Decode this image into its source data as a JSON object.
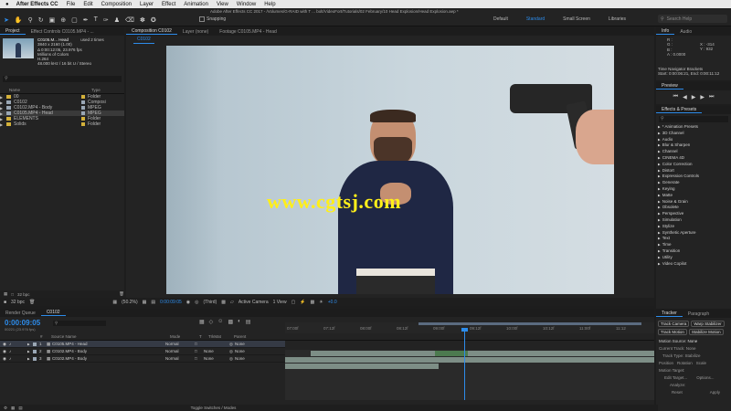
{
  "menubar": {
    "apple": "",
    "items": [
      "After Effects CC",
      "File",
      "Edit",
      "Composition",
      "Layer",
      "Effect",
      "Animation",
      "View",
      "Window",
      "Help"
    ]
  },
  "window": {
    "title": "Adobe After Effects CC 2017 - /Volumes/G-RAID with T ... bolt/VideoFort/Tutorials/02 February/10 Head Explosion/Head Explosion.aep *"
  },
  "toolbar": {
    "snapping": "Snapping",
    "workspaces": [
      "Default",
      "Standard",
      "Small Screen",
      "Libraries"
    ],
    "active_workspace": "Standard",
    "search_placeholder": "Search Help"
  },
  "project_panel": {
    "tabs": [
      "Project",
      "Effect Controls C0105.MP4 - ..."
    ],
    "selected_name": "C0105.M... Head",
    "used": "used 2 times",
    "info_lines": [
      "3840 x 2160 (1.00)",
      "Δ 0:00:12:05, 23.976 fps",
      "Millions of Colors",
      "H.264",
      "48.000 kHz / 16 bit U / Stereo"
    ],
    "columns": [
      "Name",
      "Type"
    ],
    "items": [
      {
        "name": "00",
        "type": "Folder",
        "color": "#d4b13a",
        "indent": 0
      },
      {
        "name": "C0102",
        "type": "Composi",
        "color": "#9aa7b5",
        "indent": 0
      },
      {
        "name": "C0102.MP4 - Body",
        "type": "MPEG",
        "color": "#9aa7b5",
        "indent": 0
      },
      {
        "name": "C0105.MP4 - Head",
        "type": "MPEG",
        "color": "#9aa7b5",
        "indent": 0,
        "selected": true
      },
      {
        "name": "ELEMENTS",
        "type": "Folder",
        "color": "#d4b13a",
        "indent": 0
      },
      {
        "name": "Solids",
        "type": "Folder",
        "color": "#d4b13a",
        "indent": 0
      }
    ],
    "bpc": "32 bpc"
  },
  "comp_panel": {
    "tabs": [
      "Composition C0102",
      "Layer (none)",
      "Footage C0105.MP4 - Head"
    ],
    "comp_tab_label": "C0102",
    "watermark": "www.cgtsj.com",
    "zoom": "(50.2%)",
    "timecode": "0:00:09:05",
    "resolution": "(Third)",
    "camera": "Active Camera",
    "view": "1 View",
    "exposure": "+0.0"
  },
  "info_panel": {
    "tabs": [
      "Info",
      "Audio"
    ],
    "rgb": [
      "R :",
      "G :",
      "B :",
      "A : 0.0000"
    ],
    "xy": [
      "X : -314",
      "Y : 932"
    ],
    "tn_title": "Time Navigator Brackets",
    "tn_range": "Start: 0:00:06:21, End: 0:00:11:12"
  },
  "preview_panel": {
    "title": "Preview"
  },
  "effects_panel": {
    "title": "Effects & Presets",
    "search_placeholder": "",
    "items": [
      "* Animation Presets",
      "3D Channel",
      "Audio",
      "Blur & Sharpen",
      "Channel",
      "CINEMA 4D",
      "Color Correction",
      "Distort",
      "Expression Controls",
      "Generate",
      "Keying",
      "Matte",
      "Noise & Grain",
      "Obsolete",
      "Perspective",
      "Simulation",
      "Stylize",
      "Synthetic Aperture",
      "Text",
      "Time",
      "Transition",
      "Utility",
      "Video Copilot"
    ]
  },
  "tracker_panel": {
    "tabs": [
      "Tracker",
      "Paragraph"
    ],
    "buttons": [
      "Track Camera",
      "Warp Stabilizer",
      "Track Motion",
      "Stabilize Motion"
    ],
    "motion_source_label": "Motion Source:",
    "motion_source_value": "None",
    "current_track": "Current Track: None",
    "track_type": "Track Type: Stabilize",
    "checks": [
      "Position",
      "Rotation",
      "Scale"
    ],
    "motion_target": "Motion Target:",
    "edit_target": "Edit Target...",
    "options": "Options...",
    "analyze": "Analyze:",
    "reset": "Reset",
    "apply": "Apply"
  },
  "timeline": {
    "tabs": [
      "Render Queue",
      "C0102"
    ],
    "timecode": "0:00:09:05",
    "frames": "00221 (23.976 fps)",
    "columns": [
      "#",
      "Source Name",
      "Mode",
      "T",
      "TrkMat",
      "Parent"
    ],
    "layers": [
      {
        "num": "1",
        "name": "C0105.MP4 - Head",
        "mode": "Normal",
        "trkmat": "",
        "parent": "None",
        "color": "#9aa7b5",
        "selected": true
      },
      {
        "num": "2",
        "name": "C0102.MP4 - Body",
        "mode": "Normal",
        "trkmat": "None",
        "parent": "None",
        "color": "#9aa7b5"
      },
      {
        "num": "3",
        "name": "C0102.MP4 - Body",
        "mode": "Normal",
        "trkmat": "None",
        "parent": "None",
        "color": "#9aa7b5"
      }
    ],
    "ruler": [
      "07:00f",
      "07:12f",
      "08:00f",
      "08:12f",
      "09:00f",
      "09:12f",
      "10:00f",
      "10:12f",
      "11:00f",
      "11:12"
    ],
    "toggle_label": "Toggle Switches / Modes"
  }
}
